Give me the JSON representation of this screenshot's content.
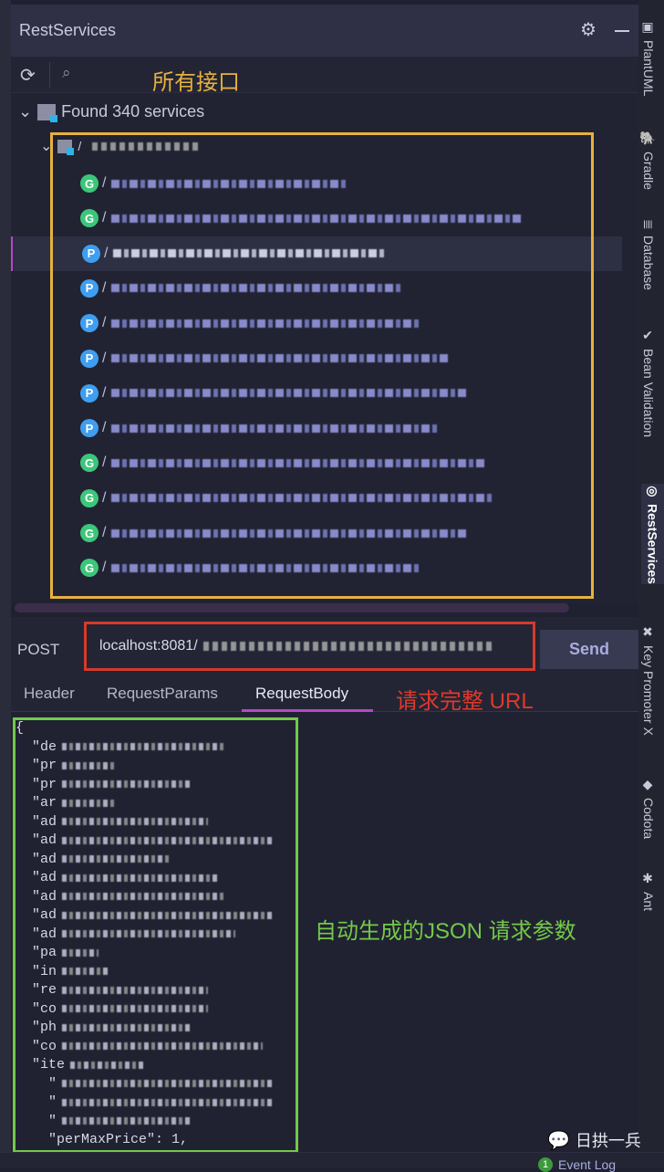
{
  "panel": {
    "title": "RestServices",
    "gear_icon": "gear-icon",
    "minimize_icon": "minimize-icon"
  },
  "toolbar": {
    "refresh_icon": "refresh-icon",
    "search_icon": "search-icon"
  },
  "annotations": {
    "all_endpoints": "所有接口",
    "full_url": "请求完整 URL",
    "auto_json": "自动生成的JSON 请求参数",
    "colors": {
      "yellow": "#e6b13f",
      "red": "#d63a2a",
      "green": "#74c948"
    }
  },
  "tree": {
    "root_label": "Found 340 services",
    "group_label": "/",
    "items": [
      {
        "method": "G",
        "path": "/"
      },
      {
        "method": "G",
        "path": "/"
      },
      {
        "method": "P",
        "path": "/",
        "selected": true
      },
      {
        "method": "P",
        "path": "/"
      },
      {
        "method": "P",
        "path": "/"
      },
      {
        "method": "P",
        "path": "/"
      },
      {
        "method": "P",
        "path": "/"
      },
      {
        "method": "P",
        "path": "/"
      },
      {
        "method": "G",
        "path": "/"
      },
      {
        "method": "G",
        "path": "/"
      },
      {
        "method": "G",
        "path": "/"
      },
      {
        "method": "G",
        "path": "/"
      }
    ],
    "method_colors": {
      "G": "#3cc67a",
      "P": "#3f9ef0"
    }
  },
  "request": {
    "method": "POST",
    "url": "localhost:8081/",
    "send_label": "Send"
  },
  "tabs": [
    {
      "label": "Header"
    },
    {
      "label": "RequestParams"
    },
    {
      "label": "RequestBody",
      "active": true
    }
  ],
  "body": {
    "lines": [
      "{",
      "  \"de",
      "  \"pr",
      "  \"pr",
      "  \"ar",
      "  \"ad",
      "  \"ad",
      "  \"ad",
      "  \"ad",
      "  \"ad",
      "  \"ad",
      "  \"ad",
      "  \"pa",
      "  \"in",
      "  \"re",
      "  \"co",
      "  \"ph",
      "  \"co",
      "  \"ite",
      "    \"",
      "    \"",
      "    \"",
      "    \"perMaxPrice\": 1,"
    ]
  },
  "right_toolbar": [
    {
      "label": "PlantUML",
      "icon": "plantuml-icon"
    },
    {
      "label": "Gradle",
      "icon": "gradle-elephant-icon"
    },
    {
      "label": "Database",
      "icon": "database-icon"
    },
    {
      "label": "Bean Validation",
      "icon": "bean-validation-icon"
    },
    {
      "label": "RestServices",
      "icon": "rest-services-icon",
      "active": true
    },
    {
      "label": "Key Promoter X",
      "icon": "key-promoter-icon"
    },
    {
      "label": "Codota",
      "icon": "codota-icon"
    },
    {
      "label": "Ant",
      "icon": "ant-icon"
    }
  ],
  "status": {
    "event_count": "1",
    "event_log": "Event Log"
  },
  "watermark": {
    "text": "日拱一兵",
    "icon": "wechat-icon"
  }
}
